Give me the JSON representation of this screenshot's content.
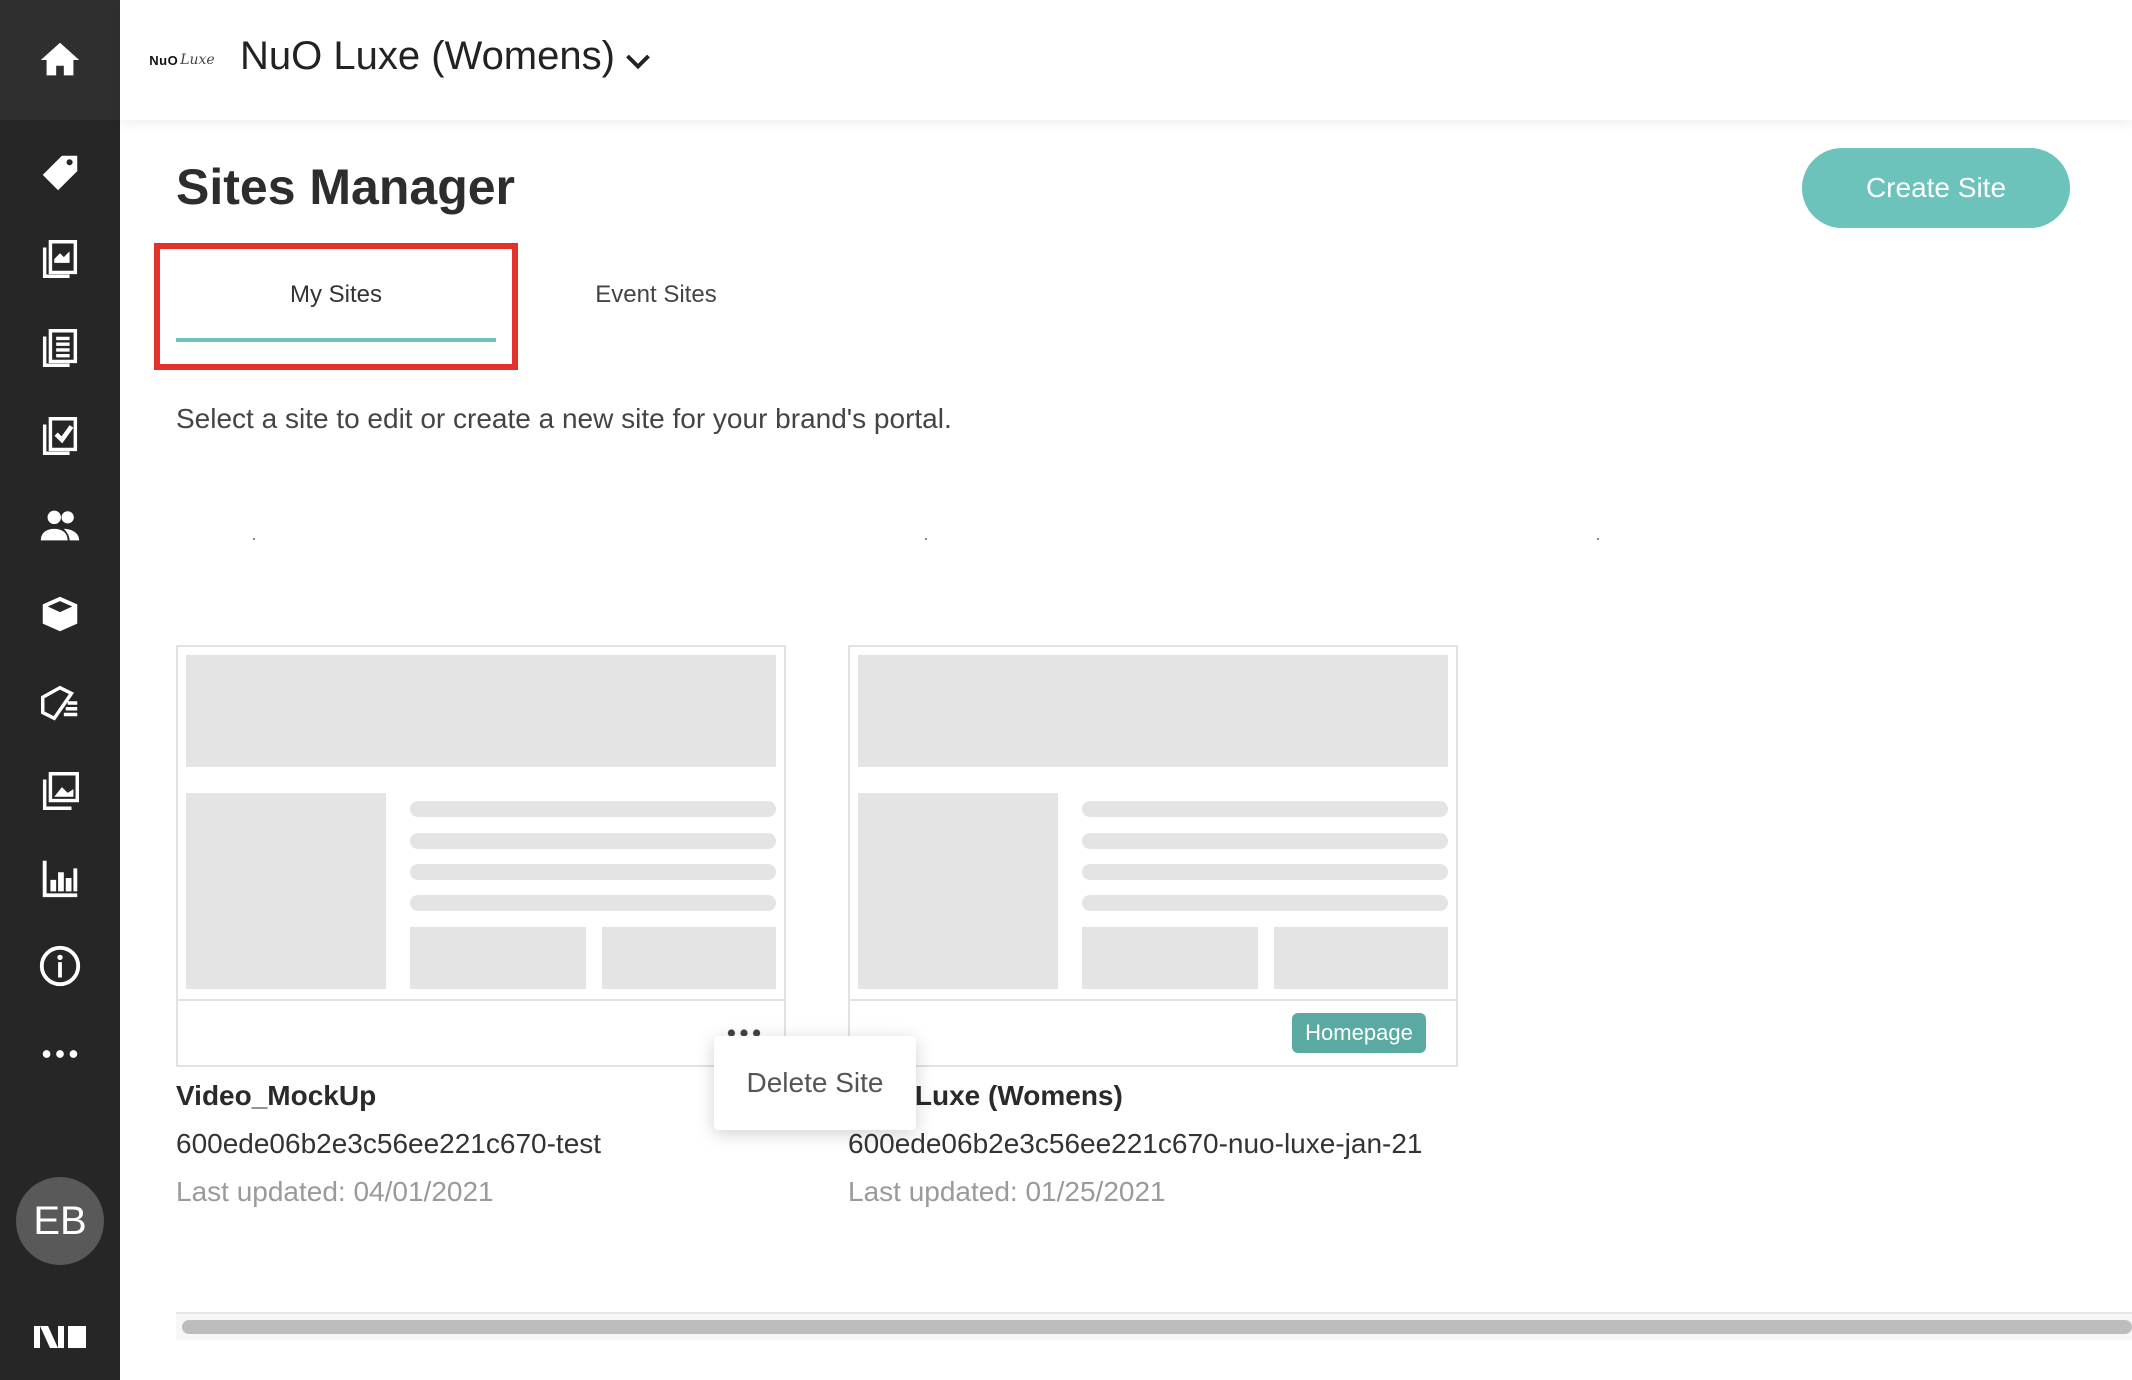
{
  "header": {
    "logo_text": "NuO",
    "logo_script": "Luxe",
    "brand_name": "NuO Luxe (Womens)"
  },
  "sidebar": {
    "icons": [
      "home-icon",
      "tag-icon",
      "catalog-icon",
      "list-icon",
      "checklist-icon",
      "users-icon",
      "box-icon",
      "mail-icon",
      "images-icon",
      "analytics-icon",
      "info-icon",
      "more-icon"
    ],
    "avatar_initials": "EB"
  },
  "page": {
    "title": "Sites Manager",
    "create_button": "Create Site",
    "subtitle": "Select a site to edit or create a new site for your brand's portal."
  },
  "tabs": [
    {
      "label": "My Sites",
      "active": true
    },
    {
      "label": "Event Sites",
      "active": false
    }
  ],
  "sites": [
    {
      "name": "Video_MockUp",
      "id": "600ede06b2e3c56ee221c670-test",
      "updated": "Last updated: 04/01/2021"
    },
    {
      "name": "NuO Luxe (Womens)",
      "id": "600ede06b2e3c56ee221c670-nuo-luxe-jan-21",
      "updated": "Last updated: 01/25/2021",
      "badge": "Homepage"
    }
  ],
  "context_menu": {
    "delete_label": "Delete Site"
  },
  "colors": {
    "accent": "#6cc3bb",
    "badge": "#5aaaa3",
    "sidebar": "#262626",
    "highlight": "#e2322a"
  }
}
